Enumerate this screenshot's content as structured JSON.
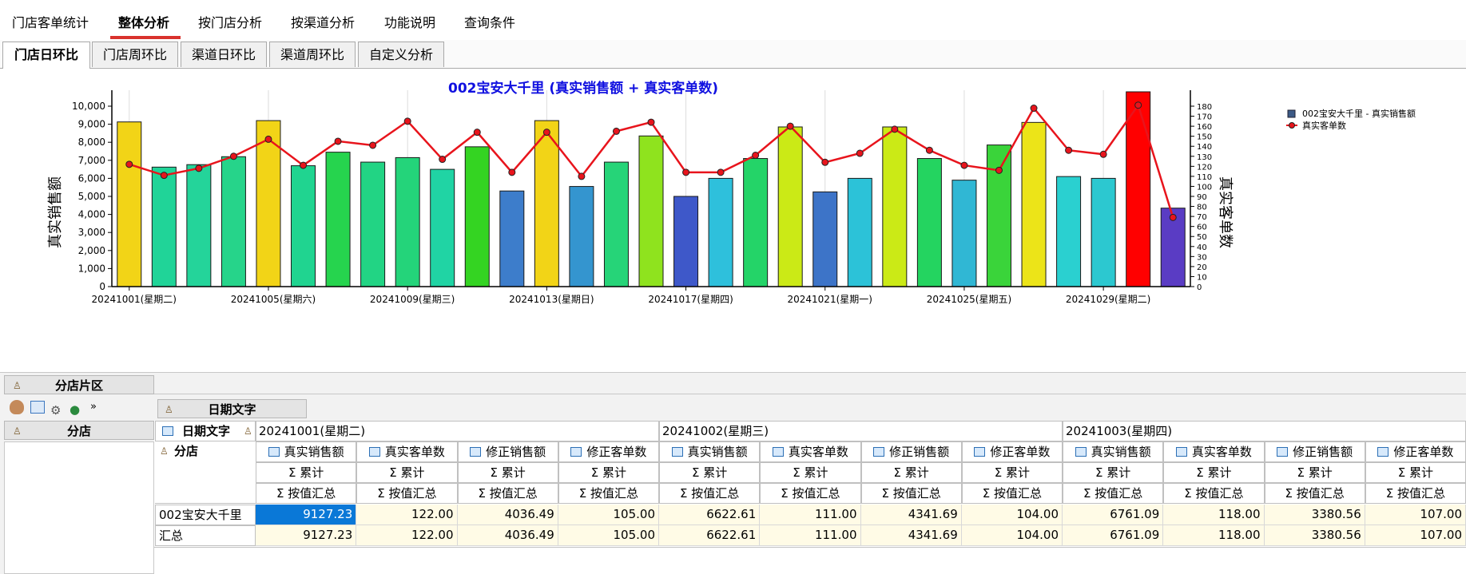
{
  "topnav": {
    "items": [
      {
        "label": "门店客单统计"
      },
      {
        "label": "整体分析",
        "active": true
      },
      {
        "label": "按门店分析"
      },
      {
        "label": "按渠道分析"
      },
      {
        "label": "功能说明"
      },
      {
        "label": "查询条件"
      }
    ]
  },
  "subtabs": {
    "items": [
      {
        "label": "门店日环比",
        "active": true
      },
      {
        "label": "门店周环比"
      },
      {
        "label": "渠道日环比"
      },
      {
        "label": "渠道周环比"
      },
      {
        "label": "自定义分析"
      }
    ]
  },
  "chart_data": {
    "type": "bar",
    "title": "002宝安大千里 (真实销售额 + 真实客单数)",
    "ylabel": "真实销售额",
    "y2label": "真实客单数",
    "ylim": [
      0,
      10000
    ],
    "y2lim": [
      0,
      180
    ],
    "ytick_labels": [
      "0",
      "1,000",
      "2,000",
      "3,000",
      "4,000",
      "5,000",
      "6,000",
      "7,000",
      "8,000",
      "9,000",
      "10,000"
    ],
    "y2tick_labels": [
      "0",
      "10",
      "20",
      "30",
      "40",
      "50",
      "60",
      "70",
      "80",
      "90",
      "100",
      "110",
      "120",
      "130",
      "140",
      "150",
      "160",
      "170",
      "180"
    ],
    "xtick_labels": [
      "20241001(星期二)",
      "20241005(星期六)",
      "20241009(星期三)",
      "20241013(星期日)",
      "20241017(星期四)",
      "20241021(星期一)",
      "20241025(星期五)",
      "20241029(星期二)"
    ],
    "legend_position": "top-right",
    "series": [
      {
        "name": "002宝安大千里 - 真实销售额",
        "kind": "bar",
        "values": [
          9127.23,
          6622.61,
          6761.09,
          7200,
          9200,
          6700,
          7450,
          6900,
          7150,
          6500,
          7750,
          5300,
          9200,
          5550,
          6900,
          8350,
          5000,
          6000,
          7100,
          8850,
          5250,
          6000,
          8850,
          7100,
          5900,
          7850,
          9100,
          6100,
          6000,
          11000,
          4350
        ]
      },
      {
        "name": "真实客单数",
        "kind": "line",
        "color": "#e8141c",
        "values": [
          122,
          111,
          118,
          130,
          147,
          121,
          145,
          141,
          165,
          127,
          154,
          114,
          154,
          110,
          155,
          164,
          114,
          114,
          131,
          160,
          124,
          133,
          157,
          136,
          121,
          116,
          178,
          136,
          132,
          181,
          69
        ]
      }
    ],
    "bar_colors": [
      "#f2d417",
      "#20d498",
      "#24d49a",
      "#26d48a",
      "#f2d417",
      "#20d490",
      "#26d44e",
      "#22d484",
      "#24d47a",
      "#20d4a4",
      "#34d422",
      "#3d7dcb",
      "#f2d417",
      "#3495cf",
      "#26d478",
      "#8fe31e",
      "#3e58c9",
      "#2ec0dc",
      "#24d468",
      "#cbea16",
      "#3d74c8",
      "#2cc2d8",
      "#cbea16",
      "#24d460",
      "#30b7d4",
      "#3ad43a",
      "#ece418",
      "#2ad0d0",
      "#2cc8d0",
      "#ff0000",
      "#5a3cc4"
    ]
  },
  "pivot": {
    "field_area_label": "分店片区",
    "column_field_label": "日期文字",
    "row_field_label": "分店",
    "col_header_label": "日期文字",
    "row_header_label": "分店",
    "dates": [
      "20241001(星期二)",
      "20241002(星期三)",
      "20241003(星期四)"
    ],
    "measures": [
      "真实销售额",
      "真实客单数",
      "修正销售额",
      "修正客单数"
    ],
    "sub1": "Σ 累计",
    "sub2": "Σ 按值汇总",
    "rows": [
      {
        "label": "002宝安大千里",
        "cells": [
          "9127.23",
          "122.00",
          "4036.49",
          "105.00",
          "6622.61",
          "111.00",
          "4341.69",
          "104.00",
          "6761.09",
          "118.00",
          "3380.56",
          "107.00"
        ]
      },
      {
        "label": "汇总",
        "cells": [
          "9127.23",
          "122.00",
          "4036.49",
          "105.00",
          "6622.61",
          "111.00",
          "4341.69",
          "104.00",
          "6761.09",
          "118.00",
          "3380.56",
          "107.00"
        ]
      }
    ]
  }
}
